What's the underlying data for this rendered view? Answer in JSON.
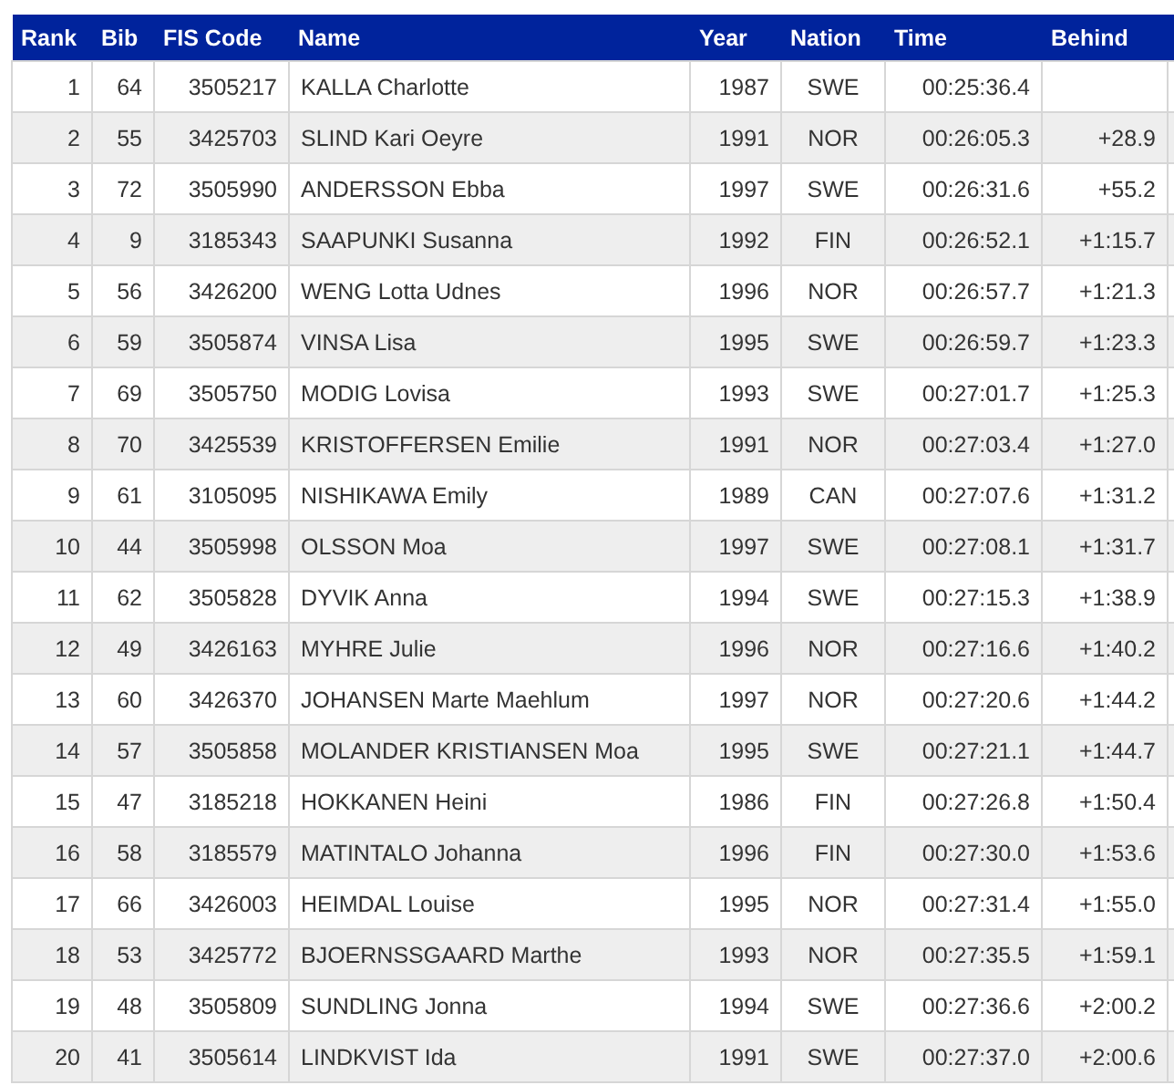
{
  "table": {
    "columns": [
      "Rank",
      "Bib",
      "FIS Code",
      "Name",
      "Year",
      "Nation",
      "Time",
      "Behind"
    ],
    "rows": [
      [
        "1",
        "64",
        "3505217",
        "KALLA Charlotte",
        "1987",
        "SWE",
        "00:25:36.4",
        ""
      ],
      [
        "2",
        "55",
        "3425703",
        "SLIND Kari Oeyre",
        "1991",
        "NOR",
        "00:26:05.3",
        "+28.9"
      ],
      [
        "3",
        "72",
        "3505990",
        "ANDERSSON Ebba",
        "1997",
        "SWE",
        "00:26:31.6",
        "+55.2"
      ],
      [
        "4",
        "9",
        "3185343",
        "SAAPUNKI Susanna",
        "1992",
        "FIN",
        "00:26:52.1",
        "+1:15.7"
      ],
      [
        "5",
        "56",
        "3426200",
        "WENG Lotta Udnes",
        "1996",
        "NOR",
        "00:26:57.7",
        "+1:21.3"
      ],
      [
        "6",
        "59",
        "3505874",
        "VINSA Lisa",
        "1995",
        "SWE",
        "00:26:59.7",
        "+1:23.3"
      ],
      [
        "7",
        "69",
        "3505750",
        "MODIG Lovisa",
        "1993",
        "SWE",
        "00:27:01.7",
        "+1:25.3"
      ],
      [
        "8",
        "70",
        "3425539",
        "KRISTOFFERSEN Emilie",
        "1991",
        "NOR",
        "00:27:03.4",
        "+1:27.0"
      ],
      [
        "9",
        "61",
        "3105095",
        "NISHIKAWA Emily",
        "1989",
        "CAN",
        "00:27:07.6",
        "+1:31.2"
      ],
      [
        "10",
        "44",
        "3505998",
        "OLSSON Moa",
        "1997",
        "SWE",
        "00:27:08.1",
        "+1:31.7"
      ],
      [
        "11",
        "62",
        "3505828",
        "DYVIK Anna",
        "1994",
        "SWE",
        "00:27:15.3",
        "+1:38.9"
      ],
      [
        "12",
        "49",
        "3426163",
        "MYHRE Julie",
        "1996",
        "NOR",
        "00:27:16.6",
        "+1:40.2"
      ],
      [
        "13",
        "60",
        "3426370",
        "JOHANSEN Marte Maehlum",
        "1997",
        "NOR",
        "00:27:20.6",
        "+1:44.2"
      ],
      [
        "14",
        "57",
        "3505858",
        "MOLANDER KRISTIANSEN Moa",
        "1995",
        "SWE",
        "00:27:21.1",
        "+1:44.7"
      ],
      [
        "15",
        "47",
        "3185218",
        "HOKKANEN Heini",
        "1986",
        "FIN",
        "00:27:26.8",
        "+1:50.4"
      ],
      [
        "16",
        "58",
        "3185579",
        "MATINTALO Johanna",
        "1996",
        "FIN",
        "00:27:30.0",
        "+1:53.6"
      ],
      [
        "17",
        "66",
        "3426003",
        "HEIMDAL Louise",
        "1995",
        "NOR",
        "00:27:31.4",
        "+1:55.0"
      ],
      [
        "18",
        "53",
        "3425772",
        "BJOERNSSGAARD Marthe",
        "1993",
        "NOR",
        "00:27:35.5",
        "+1:59.1"
      ],
      [
        "19",
        "48",
        "3505809",
        "SUNDLING Jonna",
        "1994",
        "SWE",
        "00:27:36.6",
        "+2:00.2"
      ],
      [
        "20",
        "41",
        "3505614",
        "LINDKVIST Ida",
        "1991",
        "SWE",
        "00:27:37.0",
        "+2:00.6"
      ]
    ]
  }
}
